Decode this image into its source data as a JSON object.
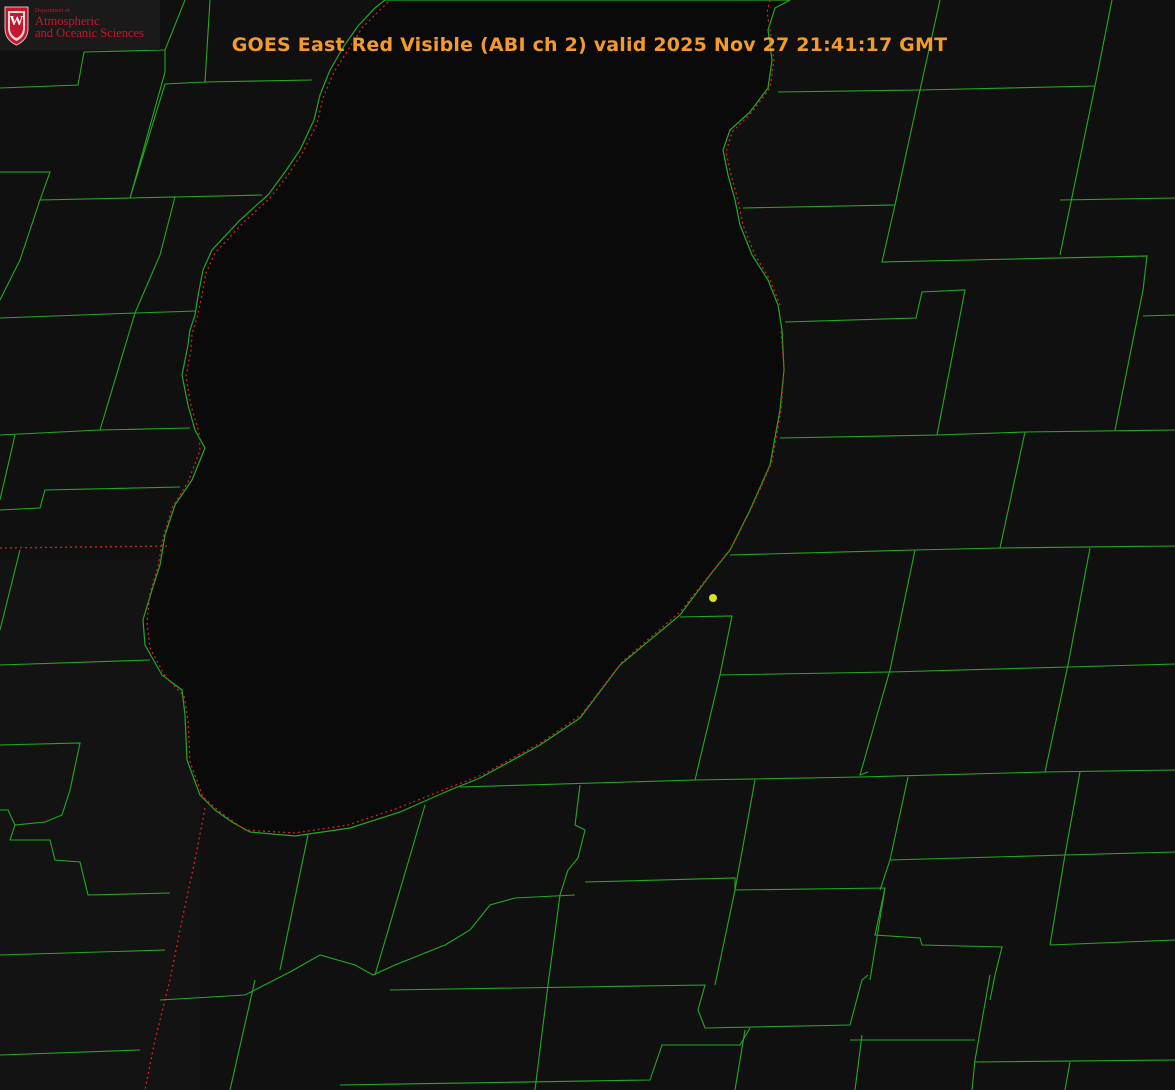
{
  "header": {
    "title": "GOES East Red Visible (ABI ch 2) valid 2025 Nov 27 21:41:17 GMT"
  },
  "logo": {
    "letter": "W",
    "department": "Department of",
    "name_line1": "Atmospheric",
    "name_line2": "and Oceanic Sciences"
  },
  "colors": {
    "background": "#0e0e0e",
    "lake": "#0a0a0a",
    "title": "#f29a2e",
    "county_lines": "#23a923",
    "state_border": "#d42020",
    "marker": "#dede20",
    "logo_red": "#c5172b"
  },
  "map": {
    "features": [
      "lake-michigan",
      "county-boundaries",
      "state-boundaries",
      "location-marker"
    ]
  }
}
